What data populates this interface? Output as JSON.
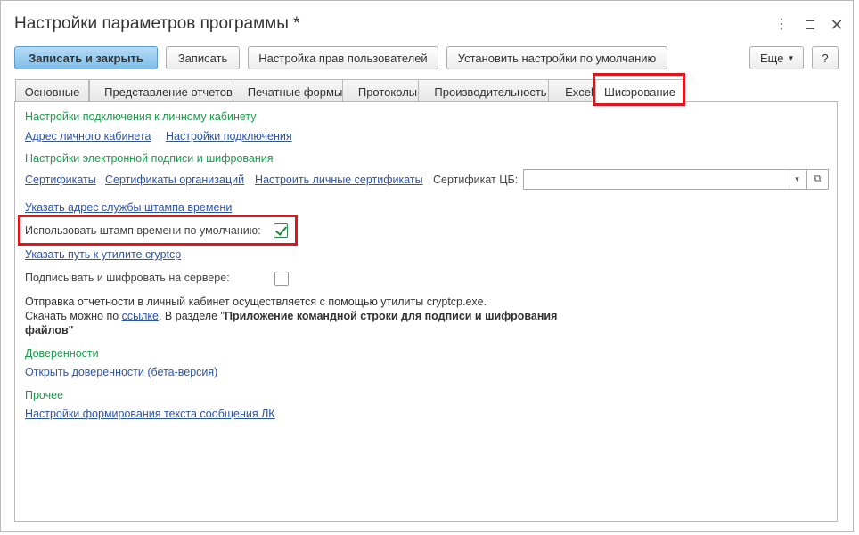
{
  "window": {
    "title": "Настройки параметров программы *",
    "more_glyph": "⋮",
    "close_glyph": "✕"
  },
  "toolbar": {
    "save_close": "Записать и закрыть",
    "save": "Записать",
    "user_rights": "Настройка прав пользователей",
    "defaults": "Установить настройки по умолчанию",
    "more": "Еще",
    "more_arrow": "▾",
    "help": "?"
  },
  "tabs": [
    {
      "label": "Основные"
    },
    {
      "label": "Представление отчетов"
    },
    {
      "label": "Печатные формы"
    },
    {
      "label": "Протоколы"
    },
    {
      "label": "Производительность"
    },
    {
      "label": "Excel"
    },
    {
      "label": "Шифрование"
    }
  ],
  "content": {
    "section_cabinet": "Настройки подключения к личному кабинету",
    "link_cabinet_address": "Адрес личного кабинета",
    "link_connection_settings": "Настройки подключения",
    "section_signature": "Настройки электронной подписи и шифрования",
    "link_certificates": "Сертификаты",
    "link_org_certificates": "Сертификаты организаций",
    "link_personal_certificates": "Настроить личные сертификаты",
    "cert_cb_label": "Сертификат ЦБ:",
    "cert_cb_value": "",
    "combo_arrow": "▾",
    "combo_open": "⧉",
    "link_timestamp_service": "Указать адрес службы штампа времени",
    "use_timestamp_label": "Использовать штамп времени по умолчанию:",
    "use_timestamp_checked": true,
    "link_cryptcp_path": "Указать путь к утилите cryptcp",
    "sign_on_server_label": "Подписывать и шифровать на сервере:",
    "sign_on_server_checked": false,
    "info_line1": "Отправка отчетности в личный кабинет осуществляется с помощью утилиты cryptcp.exe.",
    "info_line2_prefix": "Скачать можно по ",
    "info_line2_link": "ссылке",
    "info_line2_mid": ". В разделе \"",
    "info_line2_bold": "Приложение командной строки для подписи и шифрования",
    "info_line3_bold": "файлов",
    "info_line3_suffix": "\"",
    "section_proxies": "Доверенности",
    "link_open_proxies": "Открыть доверенности (бета-версия)",
    "section_other": "Прочее",
    "link_lk_message_settings": "Настройки формирования текста сообщения ЛК"
  },
  "colors": {
    "section": "#1d9a4a",
    "link": "#2c54a8",
    "highlight": "#e0161c"
  }
}
